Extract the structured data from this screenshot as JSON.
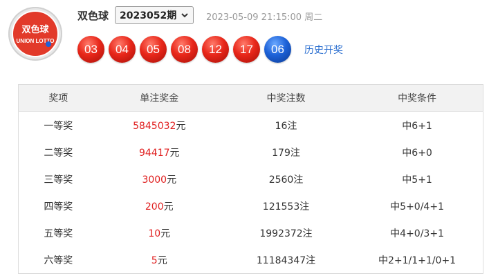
{
  "header": {
    "game_name": "双色球",
    "issue": "2023052期",
    "draw_time": "2023-05-09 21:15:00 周二",
    "logo_text": "双色球",
    "logo_subtext": "UNION LOTTO",
    "history_link": "历史开奖"
  },
  "balls": {
    "red": [
      "03",
      "04",
      "05",
      "08",
      "12",
      "17"
    ],
    "blue": "06"
  },
  "colors": {
    "red_ball": "#e8271a",
    "blue_ball": "#1d62d8",
    "amount_text": "#e02020",
    "link": "#2b6fd0"
  },
  "table": {
    "headers": [
      "奖项",
      "单注奖金",
      "中奖注数",
      "中奖条件"
    ],
    "rows": [
      {
        "level": "一等奖",
        "amount": "5845032",
        "unit": "元",
        "count": "16注",
        "condition": "中6+1"
      },
      {
        "level": "二等奖",
        "amount": "94417",
        "unit": "元",
        "count": "179注",
        "condition": "中6+0"
      },
      {
        "level": "三等奖",
        "amount": "3000",
        "unit": "元",
        "count": "2560注",
        "condition": "中5+1"
      },
      {
        "level": "四等奖",
        "amount": "200",
        "unit": "元",
        "count": "121553注",
        "condition": "中5+0/4+1"
      },
      {
        "level": "五等奖",
        "amount": "10",
        "unit": "元",
        "count": "1992372注",
        "condition": "中4+0/3+1"
      },
      {
        "level": "六等奖",
        "amount": "5",
        "unit": "元",
        "count": "11184347注",
        "condition": "中2+1/1+1/0+1"
      }
    ]
  }
}
